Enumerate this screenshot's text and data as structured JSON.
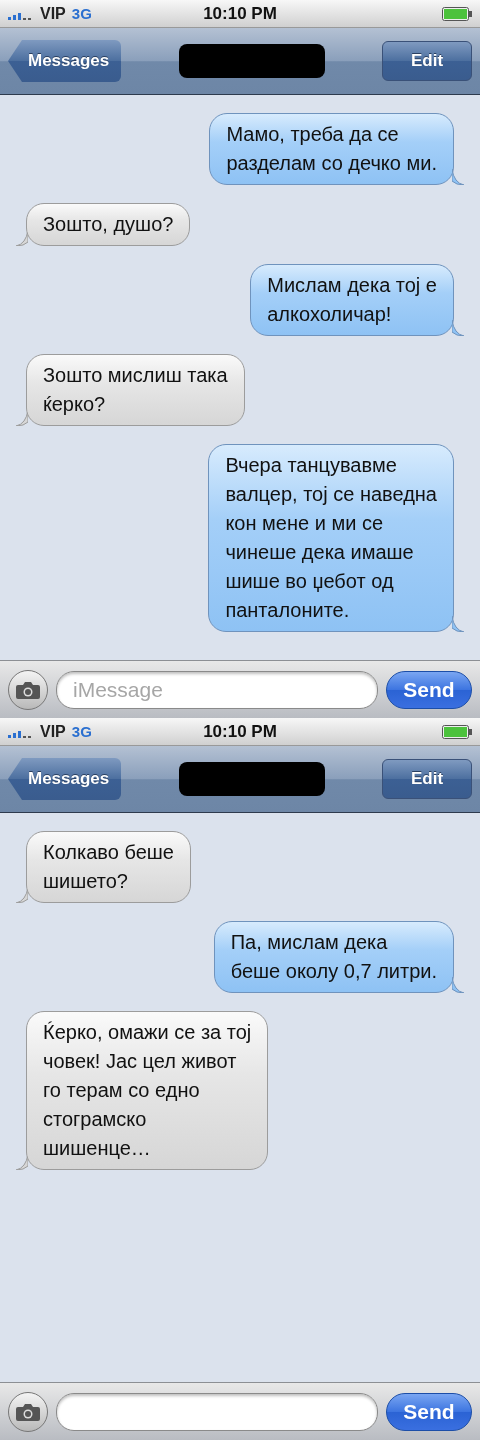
{
  "screens": [
    {
      "status_bar": {
        "carrier": "VIP",
        "network": "3G",
        "time": "10:10 PM"
      },
      "nav_bar": {
        "back": "Messages",
        "edit": "Edit"
      },
      "messages": [
        {
          "kind": "sent",
          "text": "Мамо, треба да се\nразделам со дечко ми."
        },
        {
          "kind": "received",
          "text": "Зошто, душо?"
        },
        {
          "kind": "sent",
          "text": "Мислам дека тој е\nалкохоличар!"
        },
        {
          "kind": "received",
          "text": "Зошто мислиш така\nќерко?"
        },
        {
          "kind": "sent",
          "text": "Вчера танцувавме\nвалцер, тој се наведна\nкон мене и ми се\nчинеше дека имаше\nшише во џебот од\nпанталоните."
        }
      ],
      "input": {
        "placeholder": "iMessage",
        "send": "Send"
      }
    },
    {
      "status_bar": {
        "carrier": "VIP",
        "network": "3G",
        "time": "10:10 PM"
      },
      "nav_bar": {
        "back": "Messages",
        "edit": "Edit"
      },
      "messages": [
        {
          "kind": "received",
          "text": "Колкаво беше\nшишето?"
        },
        {
          "kind": "sent",
          "text": "Па, мислам дека\nбеше околу 0,7 литри."
        },
        {
          "kind": "received",
          "text": "Ќерко, омажи се за тој\nчовек! Јас цел живот\nго терам со едно\nстограмско\nшишенце…"
        }
      ],
      "input": {
        "send": "Send"
      }
    }
  ]
}
